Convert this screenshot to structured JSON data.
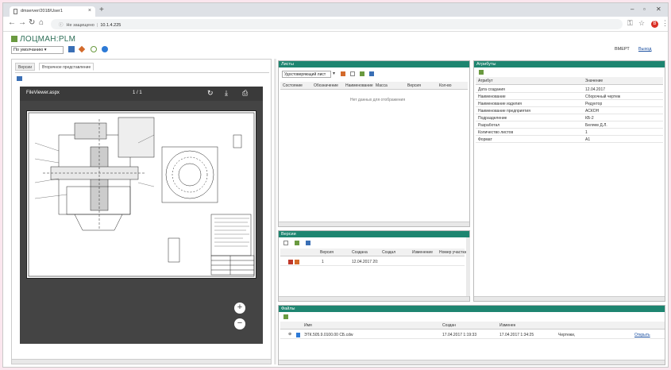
{
  "browser": {
    "tab_title": "dmserver/2018/User1",
    "protocol_text": "Не защищено",
    "host": "10.1.4.225",
    "window_controls": [
      "–",
      "▫",
      "✕"
    ],
    "avatar_letter": "В"
  },
  "app": {
    "logo_text": "ЛОЦМАН:PLM",
    "view_select": "По умолчанию",
    "user": "ВМЕРТ",
    "exit_label": "Выход"
  },
  "left_pane": {
    "tabs": [
      "Версии",
      "Вторичное представление"
    ],
    "viewer_file": "FileViewer.aspx",
    "page_indicator": "1 / 1",
    "zoom_in": "+",
    "zoom_out": "−"
  },
  "sheets_panel": {
    "title": "Листы",
    "filter_value": "Удостоверяющий лист",
    "columns": [
      "Состояние",
      "Обозначение",
      "Наименование",
      "Масса",
      "Версия",
      "Кол-во"
    ],
    "empty_text": "Нет данных для отображения"
  },
  "versions_panel": {
    "title": "Версии",
    "columns": [
      "Версия",
      "Создана",
      "Создал",
      "Изменение",
      "Номер участка"
    ],
    "rows": [
      {
        "version": "1",
        "created": "12.04.2017 20:"
      }
    ]
  },
  "attributes_panel": {
    "title": "Атрибуты",
    "columns": [
      "Атрибут",
      "Значение"
    ],
    "rows": [
      {
        "attr": "Дата создания",
        "value": "12.04.2017"
      },
      {
        "attr": "Наименование",
        "value": "Сборочный чертеж"
      },
      {
        "attr": "Наименование изделия",
        "value": "Редуктор"
      },
      {
        "attr": "Наименование предприятия",
        "value": "АСКОН"
      },
      {
        "attr": "Подразделение",
        "value": "КБ-2"
      },
      {
        "attr": "Разработал",
        "value": "Беляев Д.Л."
      },
      {
        "attr": "Количество листов",
        "value": "1"
      },
      {
        "attr": "Формат",
        "value": "А1"
      }
    ]
  },
  "files_panel": {
    "title": "Файлы",
    "columns": [
      "Имя",
      "Создан",
      "Изменен"
    ],
    "rows": [
      {
        "name": "ЭТК.505.9.0100.00 СБ.cdw",
        "created": "17.04.2017 1:19:33",
        "modified": "17.04.2017 1:34:25",
        "type": "Чертежи,",
        "action": "Открыть"
      }
    ]
  },
  "colors": {
    "panel_header": "#1e8570",
    "page_bg": "#fbe6ee",
    "viewer_bg": "#444444"
  }
}
